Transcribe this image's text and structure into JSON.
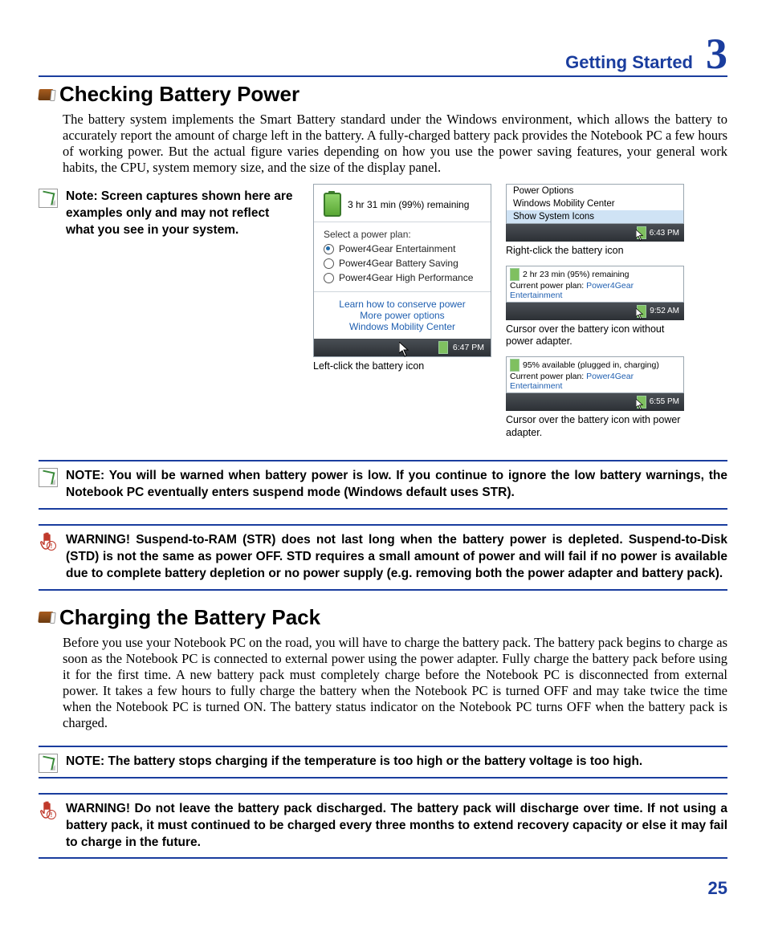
{
  "header": {
    "section": "Getting Started",
    "chapter": "3"
  },
  "page_number": "25",
  "s1": {
    "title": "Checking Battery Power",
    "body": "The battery system implements the Smart Battery standard under the Windows environment, which allows the battery to accurately report the amount of charge left in the battery. A fully-charged battery pack provides the Notebook PC a few hours of working power. But the actual figure varies depending on how you use the power saving features, your general work habits, the CPU, system memory size, and the size of the display panel.",
    "note_left": "Note: Screen captures shown here are examples only and may not reflect what you see in your system.",
    "popup": {
      "remaining": "3 hr 31 min (99%) remaining",
      "select_label": "Select a power plan:",
      "plan1": "Power4Gear Entertainment",
      "plan2": "Power4Gear Battery Saving",
      "plan3": "Power4Gear High Performance",
      "link1": "Learn how to conserve power",
      "link2": "More power options",
      "link3": "Windows Mobility Center",
      "time": "6:47 PM"
    },
    "caption_left": "Left-click the battery icon",
    "ctx": {
      "opt1": "Power Options",
      "opt2": "Windows Mobility Center",
      "opt3": "Show System Icons",
      "time": "6:43 PM"
    },
    "caption_ctx": "Right-click the battery icon",
    "tip1": {
      "line1": "2 hr 23 min (95%) remaining",
      "line2a": "Current power plan:",
      "line2b": "Power4Gear Entertainment",
      "time": "9:52 AM"
    },
    "caption_tip1": "Cursor over the battery icon without power adapter.",
    "tip2": {
      "line1": "95% available (plugged in, charging)",
      "line2a": "Current power plan:",
      "line2b": "Power4Gear Entertainment",
      "time": "6:55 PM"
    },
    "caption_tip2": "Cursor over the battery icon with power adapter."
  },
  "callouts": {
    "note1": "NOTE: You will be warned when battery power is low. If you continue to ignore the low battery warnings, the Notebook PC eventually enters suspend mode (Windows default uses STR).",
    "warn1": "WARNING!  Suspend-to-RAM (STR) does not last long when the battery power is depleted. Suspend-to-Disk (STD) is not the same as power OFF. STD requires a small amount of power and will fail if no power is available due to complete battery depletion or no power supply (e.g. removing both the power adapter and battery pack)."
  },
  "s2": {
    "title": "Charging the Battery Pack",
    "body": "Before you use your Notebook PC on the road, you will have to charge the battery pack. The battery pack begins to charge as soon as the Notebook PC is connected to external power using the power adapter. Fully charge the battery pack before using it for the first time. A new battery pack must completely charge before the Notebook PC is disconnected from external power. It takes a few hours to fully charge the battery when the Notebook PC is turned OFF and may take twice the time when the Notebook PC is turned ON. The battery status indicator on the Notebook PC turns OFF when the battery pack is charged."
  },
  "callouts2": {
    "note2": "NOTE: The battery stops charging if the temperature is too high or the battery voltage is too high.",
    "warn2": "WARNING!  Do not leave the battery pack discharged. The battery pack will discharge over time. If not using a battery pack, it must continued to be charged every three months to extend recovery capacity or else it may fail to charge in the future."
  }
}
